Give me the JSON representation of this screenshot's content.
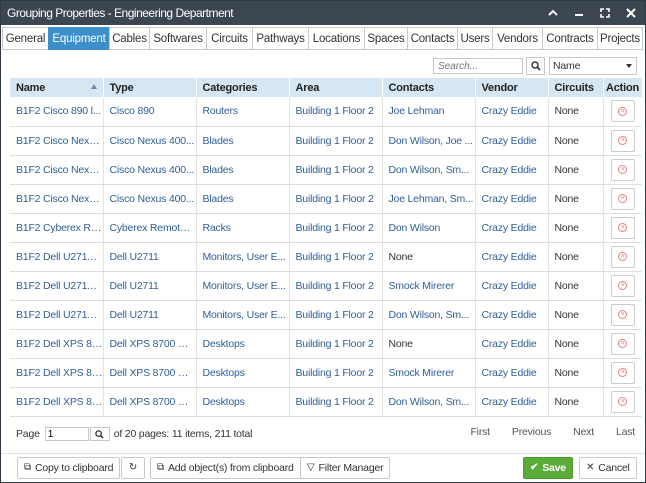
{
  "window": {
    "title": "Grouping Properties - Engineering Department"
  },
  "tabs": [
    {
      "label": "General"
    },
    {
      "label": "Equipment"
    },
    {
      "label": "Cables"
    },
    {
      "label": "Softwares"
    },
    {
      "label": "Circuits"
    },
    {
      "label": "Pathways"
    },
    {
      "label": "Locations"
    },
    {
      "label": "Spaces"
    },
    {
      "label": "Contacts"
    },
    {
      "label": "Users"
    },
    {
      "label": "Vendors"
    },
    {
      "label": "Contracts"
    },
    {
      "label": "Projects"
    }
  ],
  "active_tab": "Equipment",
  "search": {
    "placeholder": "Search..."
  },
  "sort_select": {
    "value": "Name"
  },
  "columns": [
    "Name",
    "Type",
    "Categories",
    "Area",
    "Contacts",
    "Vendor",
    "Circuits",
    "Action"
  ],
  "rows": [
    [
      "B1F2 Cisco 890 l...",
      "Cisco 890",
      "Routers",
      "Building 1 Floor 2",
      "Joe Lehman",
      "Crazy Eddie",
      "None"
    ],
    [
      "B1F2 Cisco Nexu...",
      "Cisco Nexus 400...",
      "Blades",
      "Building 1 Floor 2",
      "Don Wilson,  Joe ...",
      "Crazy Eddie",
      "None"
    ],
    [
      "B1F2 Cisco Nexu...",
      "Cisco Nexus 400...",
      "Blades",
      "Building 1 Floor 2",
      "Don Wilson,  Sm...",
      "Crazy Eddie",
      "None"
    ],
    [
      "B1F2 Cisco Nexu...",
      "Cisco Nexus 400...",
      "Blades",
      "Building 1 Floor 2",
      "Joe Lehman,  Sm...",
      "Crazy Eddie",
      "None"
    ],
    [
      "B1F2 Cyberex Re...",
      "Cyberex Remote ...",
      "Racks",
      "Building 1 Floor 2",
      "Don Wilson",
      "Crazy Eddie",
      "None"
    ],
    [
      "B1F2 Dell U2711 ...",
      "Dell U2711",
      "Monitors,  User E...",
      "Building 1 Floor 2",
      "None",
      "Crazy Eddie",
      "None"
    ],
    [
      "B1F2 Dell U2711 ...",
      "Dell U2711",
      "Monitors,  User E...",
      "Building 1 Floor 2",
      "Smock Mirerer",
      "Crazy Eddie",
      "None"
    ],
    [
      "B1F2 Dell U2711 ...",
      "Dell U2711",
      "Monitors,  User E...",
      "Building 1 Floor 2",
      "Don Wilson,  Sm...",
      "Crazy Eddie",
      "None"
    ],
    [
      "B1F2 Dell XPS 87...",
      "Dell XPS 8700 De...",
      "Desktops",
      "Building 1 Floor 2",
      "None",
      "Crazy Eddie",
      "None"
    ],
    [
      "B1F2 Dell XPS 87...",
      "Dell XPS 8700 De...",
      "Desktops",
      "Building 1 Floor 2",
      "Smock Mirerer",
      "Crazy Eddie",
      "None"
    ],
    [
      "B1F2 Dell XPS 87...",
      "Dell XPS 8700 De...",
      "Desktops",
      "Building 1 Floor 2",
      "Don Wilson,  Sm...",
      "Crazy Eddie",
      "None"
    ]
  ],
  "pager": {
    "page_label": "Page",
    "page_value": "1",
    "summary": "of 20 pages: 11 items, 211 total",
    "first": "First",
    "previous": "Previous",
    "next": "Next",
    "last": "Last"
  },
  "footer": {
    "copy": "Copy to clipboard",
    "add": "Add object(s) from clipboard",
    "filter": "Filter Manager",
    "save": "Save",
    "cancel": "Cancel"
  },
  "colors": {
    "titlebar": "#3b4650",
    "accent": "#3d8fc9",
    "save": "#5aab38",
    "header": "#d6e6f3",
    "link": "#2f5f96"
  }
}
